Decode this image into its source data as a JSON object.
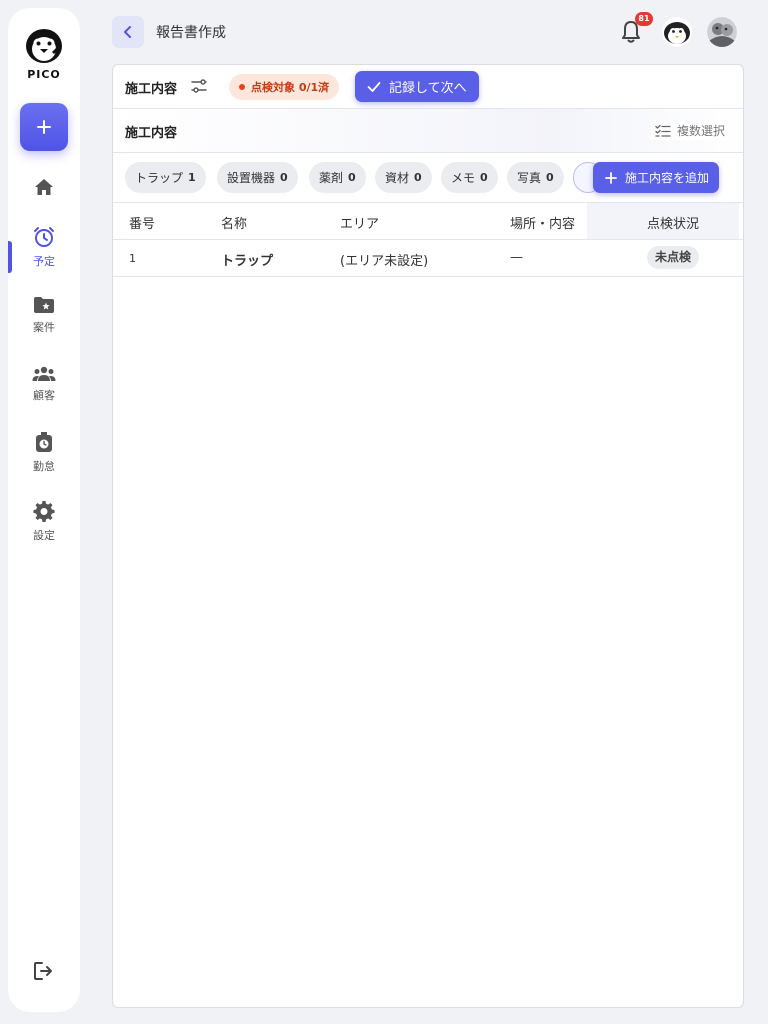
{
  "sidebar": {
    "logo_text": "PICO",
    "add_label": "+",
    "items": [
      {
        "label": "",
        "icon": "home-icon"
      },
      {
        "label": "予定",
        "icon": "alarm-clock-icon",
        "active": true
      },
      {
        "label": "案件",
        "icon": "folder-star-icon"
      },
      {
        "label": "顧客",
        "icon": "users-icon"
      },
      {
        "label": "勤怠",
        "icon": "timecard-icon"
      },
      {
        "label": "設定",
        "icon": "gear-icon"
      }
    ],
    "logout_icon": "logout-icon"
  },
  "header": {
    "title": "報告書作成",
    "notification_count": "81"
  },
  "toolbar": {
    "section_title": "施工内容",
    "inspection_status": "点検対象 0/1済",
    "record_next_label": "記録して次へ"
  },
  "subheader": {
    "title": "施工内容",
    "multi_select_label": "複数選択"
  },
  "chips": [
    {
      "label": "トラップ",
      "count": "1"
    },
    {
      "label": "設置機器",
      "count": "0"
    },
    {
      "label": "薬剤",
      "count": "0"
    },
    {
      "label": "資材",
      "count": "0"
    },
    {
      "label": "メモ",
      "count": "0"
    },
    {
      "label": "写真",
      "count": "0"
    }
  ],
  "add_content_label": "施工内容を追加",
  "table": {
    "columns": [
      "番号",
      "名称",
      "エリア",
      "場所・内容",
      "点検状況"
    ],
    "rows": [
      {
        "number": "1",
        "name": "トラップ",
        "area": "(エリア未設定)",
        "location": "—",
        "status": "未点検"
      }
    ]
  },
  "colors": {
    "accent": "#5a5fe8",
    "warning_bg": "#fde7dd",
    "warning_text": "#c23c12",
    "badge": "#e53935"
  }
}
